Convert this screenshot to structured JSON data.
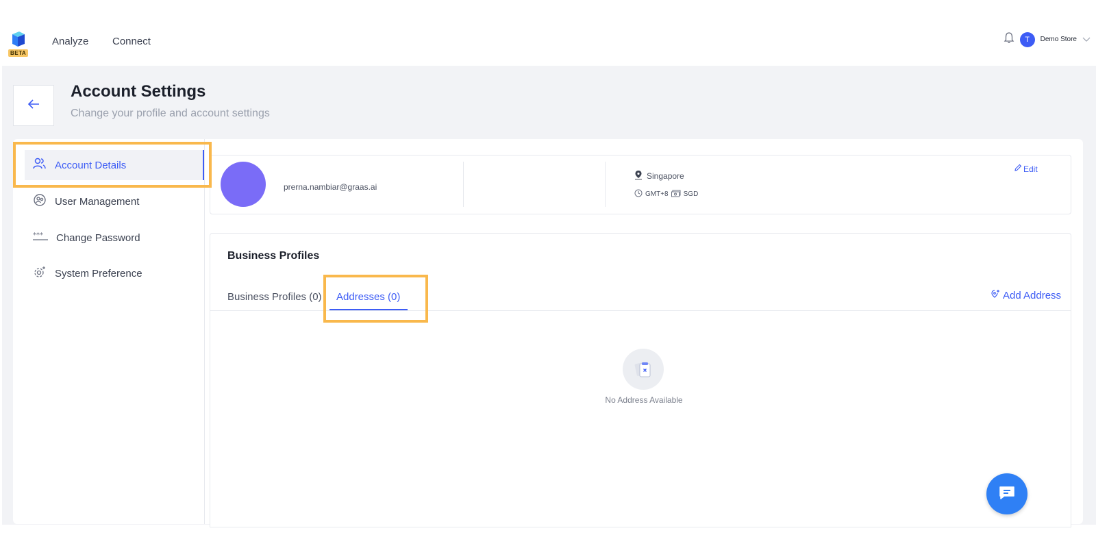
{
  "topbar": {
    "beta_label": "BETA",
    "nav": [
      "Analyze",
      "Connect"
    ],
    "avatar_initial": "T",
    "store_name": "Demo Store"
  },
  "header": {
    "title": "Account Settings",
    "subtitle": "Change your profile and account settings"
  },
  "sidebar": {
    "items": [
      {
        "label": "Account Details",
        "icon": "users-icon"
      },
      {
        "label": "User Management",
        "icon": "user-circle-icon"
      },
      {
        "label": "Change Password",
        "icon": "password-icon"
      },
      {
        "label": "System Preference",
        "icon": "gear-icon"
      }
    ]
  },
  "profile": {
    "email": "prerna.nambiar@graas.ai",
    "location": "Singapore",
    "timezone": "GMT+8",
    "currency": "SGD",
    "edit_label": "Edit"
  },
  "business": {
    "title": "Business Profiles",
    "tabs": [
      {
        "label": "Business Profiles (0)"
      },
      {
        "label": "Addresses (0)"
      }
    ],
    "add_address_label": "Add Address",
    "empty_text": "No Address Available"
  },
  "colors": {
    "accent": "#3d5cf5",
    "highlight": "#f9b84c",
    "avatar": "#7a6cf7"
  }
}
